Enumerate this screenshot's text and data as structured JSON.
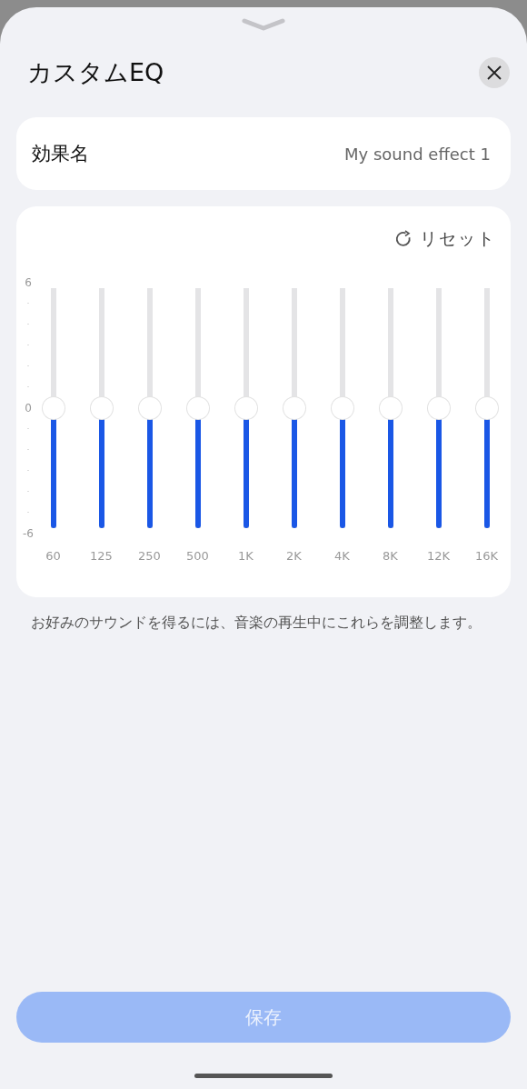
{
  "title": "カスタムEQ",
  "effect_name": {
    "label": "効果名",
    "value": "My sound effect 1"
  },
  "reset": {
    "label": "リセット"
  },
  "scale": {
    "max": "6",
    "zero": "0",
    "min": "-6"
  },
  "bands": [
    {
      "label": "60",
      "level": 0.5
    },
    {
      "label": "125",
      "level": 0.5
    },
    {
      "label": "250",
      "level": 0.5
    },
    {
      "label": "500",
      "level": 0.5
    },
    {
      "label": "1K",
      "level": 0.5
    },
    {
      "label": "2K",
      "level": 0.5
    },
    {
      "label": "4K",
      "level": 0.5
    },
    {
      "label": "8K",
      "level": 0.5
    },
    {
      "label": "12K",
      "level": 0.5
    },
    {
      "label": "16K",
      "level": 0.5
    }
  ],
  "hint": "お好みのサウンドを得るには、音楽の再生中にこれらを調整します。",
  "save_button": {
    "label": "保存",
    "disabled": true
  }
}
